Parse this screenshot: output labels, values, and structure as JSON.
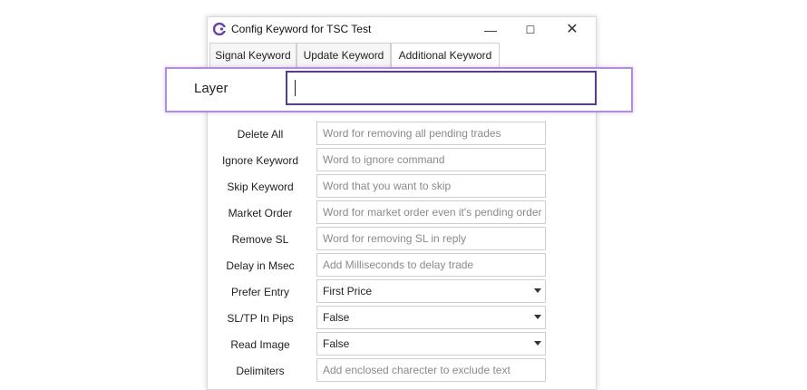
{
  "window": {
    "title": "Config Keyword for TSC Test",
    "min_glyph": "—",
    "max_glyph": "☐",
    "close_glyph": "✕"
  },
  "tabs": [
    {
      "label": "Signal Keyword",
      "active": false
    },
    {
      "label": "Update Keyword",
      "active": false
    },
    {
      "label": "Additional Keyword",
      "active": true
    }
  ],
  "highlight": {
    "label": "Layer",
    "value": ""
  },
  "rows": [
    {
      "label": "Delete All",
      "type": "text",
      "value": "",
      "placeholder": "Word for removing all pending trades"
    },
    {
      "label": "Ignore Keyword",
      "type": "text",
      "value": "",
      "placeholder": "Word to ignore command"
    },
    {
      "label": "Skip Keyword",
      "type": "text",
      "value": "",
      "placeholder": "Word that you want to skip"
    },
    {
      "label": "Market Order",
      "type": "text",
      "value": "",
      "placeholder": "Word for market order even it's pending order"
    },
    {
      "label": "Remove SL",
      "type": "text",
      "value": "",
      "placeholder": "Word for removing SL in reply"
    },
    {
      "label": "Delay in Msec",
      "type": "text",
      "value": "",
      "placeholder": "Add Milliseconds to delay trade"
    },
    {
      "label": "Prefer Entry",
      "type": "select",
      "value": "First Price"
    },
    {
      "label": "SL/TP In Pips",
      "type": "select",
      "value": "False"
    },
    {
      "label": "Read Image",
      "type": "select",
      "value": "False"
    },
    {
      "label": "Delimiters",
      "type": "text",
      "value": "",
      "placeholder": "Add enclosed charecter to exclude text"
    }
  ],
  "colors": {
    "accent": "#5a3c8e",
    "highlight_border": "#b18cdf"
  }
}
